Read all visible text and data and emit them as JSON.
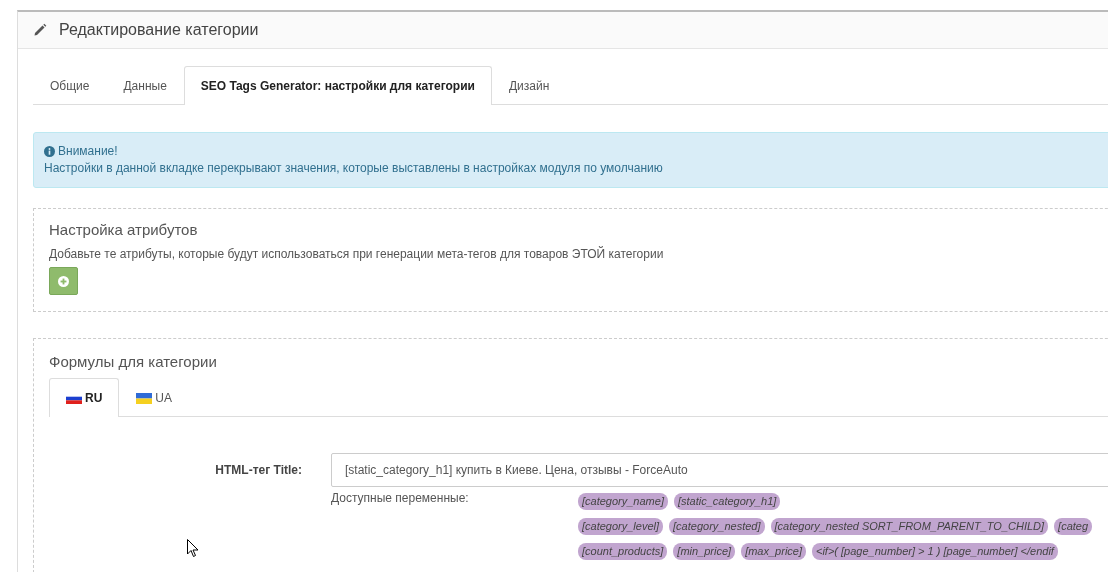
{
  "panel": {
    "title": "Редактирование категории"
  },
  "tabs": [
    {
      "label": "Общие",
      "selected": false
    },
    {
      "label": "Данные",
      "selected": false
    },
    {
      "label": "SEO Tags Generator: настройки для категории",
      "selected": true
    },
    {
      "label": "Дизайн",
      "selected": false
    }
  ],
  "alert": {
    "title": "Внимание!",
    "text": "Настройки в данной вкладке перекрывают значения, которые выставлены в настройках модуля по умолчанию"
  },
  "attributes_section": {
    "title": "Настройка атрибутов",
    "description": "Добавьте те атрибуты, которые будут использоваться при генерации мета-тегов для товаров ЭТОЙ категории"
  },
  "formulas_section": {
    "title": "Формулы для категории",
    "language_tabs": [
      {
        "label": "RU",
        "kind": "ru",
        "selected": true
      },
      {
        "label": "UA",
        "kind": "ua",
        "selected": false
      }
    ],
    "field": {
      "label": "HTML-тег Title:",
      "value": "[static_category_h1] купить в Киеве. Цена, отзывы - ForceAuto"
    },
    "variables_label": "Доступные переменные:",
    "variable_rows": [
      [
        "[category_name]",
        "[static_category_h1]"
      ],
      [
        "[category_level]",
        "[category_nested]",
        "[category_nested SORT_FROM_PARENT_TO_CHILD]",
        "[categ"
      ],
      [
        "[count_products]",
        "[min_price]",
        "[max_price]",
        "<if>( [page_number] > 1 ) [page_number] </endif"
      ]
    ]
  }
}
